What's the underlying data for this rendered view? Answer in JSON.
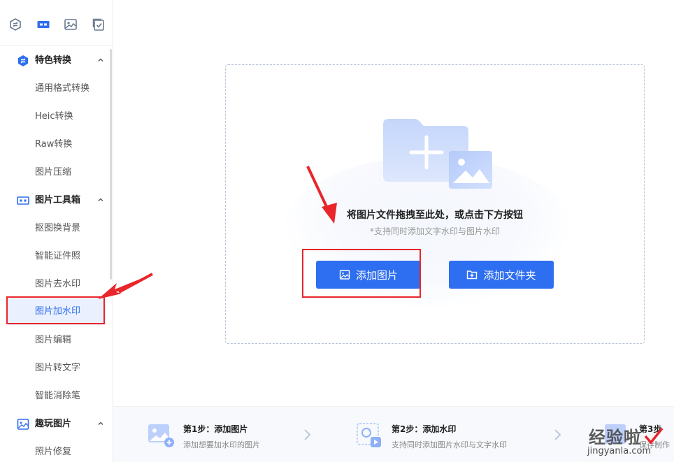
{
  "sidebar": {
    "top_icons": [
      {
        "name": "convert-icon"
      },
      {
        "name": "toolbox-icon"
      },
      {
        "name": "image-fun-icon"
      },
      {
        "name": "checklist-icon"
      }
    ],
    "sections": [
      {
        "label": "特色转换",
        "icon": "convert-icon",
        "items": [
          "通用格式转换",
          "Heic转换",
          "Raw转换",
          "图片压缩"
        ]
      },
      {
        "label": "图片工具箱",
        "icon": "toolbox-icon",
        "items": [
          "抠图换背景",
          "智能证件照",
          "图片去水印",
          "图片加水印",
          "图片编辑",
          "图片转文字",
          "智能消除笔"
        ]
      },
      {
        "label": "趣玩图片",
        "icon": "image-fun-icon",
        "items": [
          "照片修复"
        ]
      }
    ],
    "active_item": "图片加水印"
  },
  "main": {
    "drop_title": "将图片文件拖拽至此处，或点击下方按钮",
    "drop_subtitle": "*支持同时添加文字水印与图片水印",
    "add_image_label": "添加图片",
    "add_folder_label": "添加文件夹"
  },
  "steps": [
    {
      "title": "第1步：添加图片",
      "desc": "添加想要加水印的图片"
    },
    {
      "title": "第2步：添加水印",
      "desc": "支持同时添加图片水印与文字水印"
    },
    {
      "title": "第3步",
      "desc": "保存制作"
    }
  ],
  "watermark": {
    "cn": "经验啦",
    "en": "jingyanla.com"
  },
  "colors": {
    "accent": "#2e6ef0",
    "annotation": "#e8262b",
    "active_bg": "#eaf0fd"
  }
}
